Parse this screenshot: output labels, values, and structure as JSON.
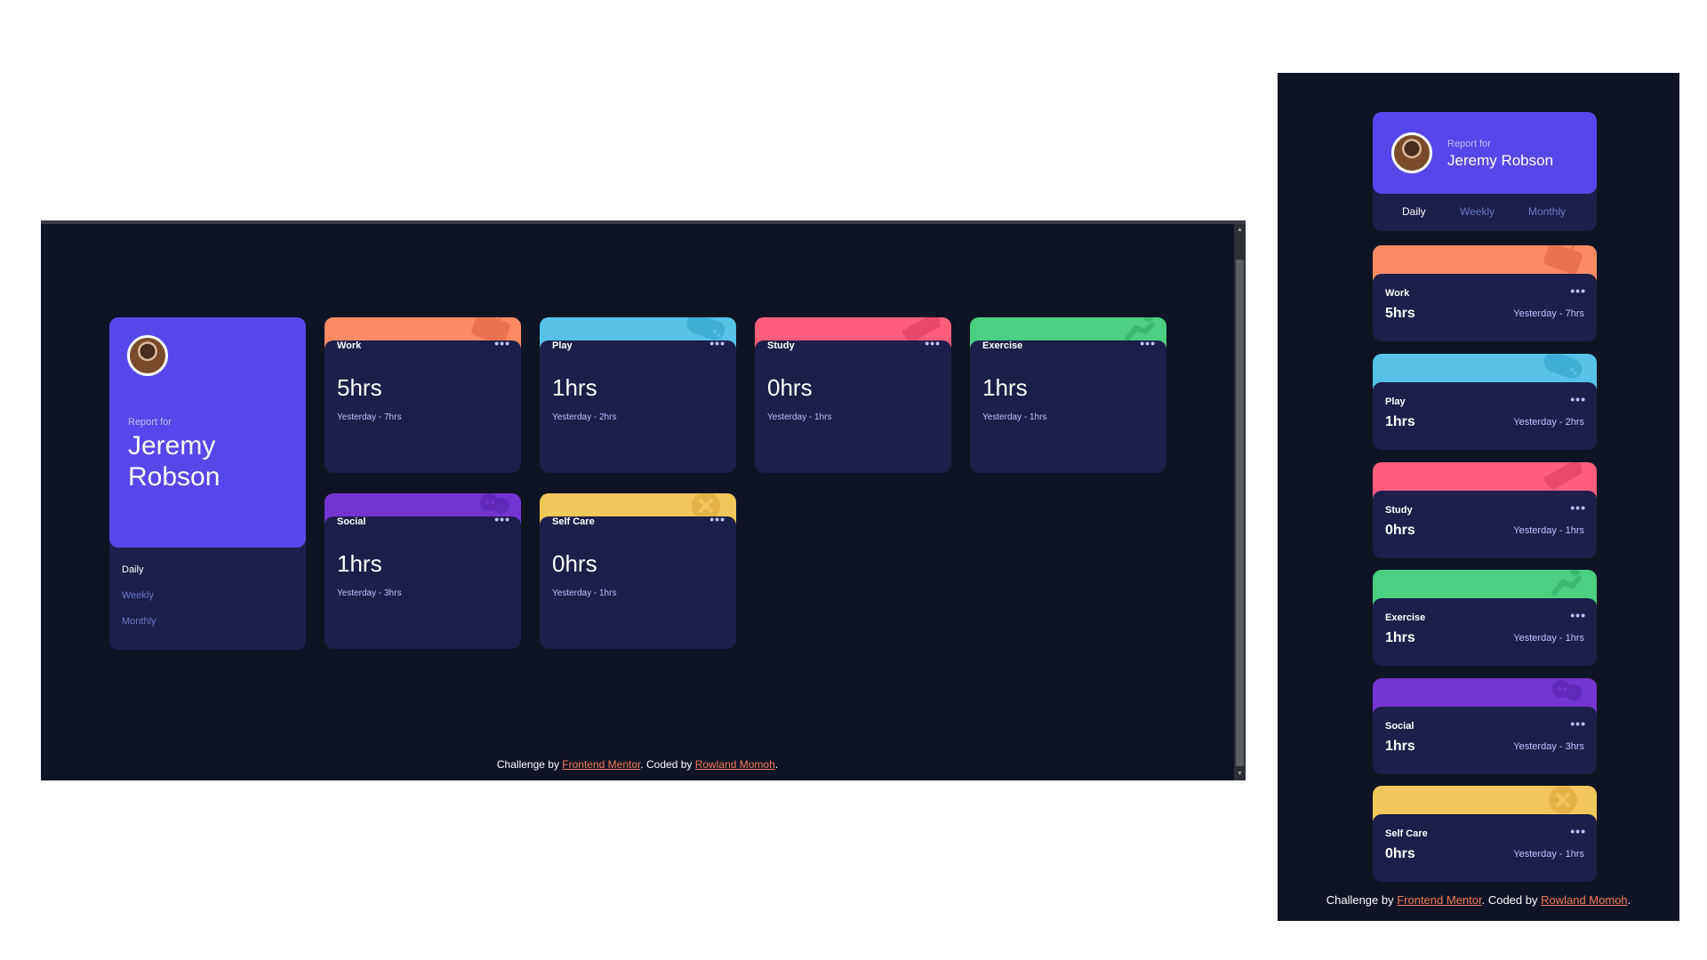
{
  "footer": {
    "prefix": "Challenge by ",
    "link1": "Frontend Mentor",
    "middle": ". Coded by ",
    "link2": "Rowland Momoh",
    "suffix": "."
  },
  "profile": {
    "report_for": "Report for",
    "name": "Jeremy Robson",
    "name_line1": "Jeremy",
    "name_line2": "Robson",
    "avatar_icon": "avatar-icon"
  },
  "periods": [
    "Daily",
    "Weekly",
    "Monthly"
  ],
  "active_period": "Daily",
  "activities": [
    {
      "title": "Work",
      "hours": "5hrs",
      "previous": "Yesterday - 7hrs",
      "color": "#ff8b64",
      "icon": "briefcase-icon"
    },
    {
      "title": "Play",
      "hours": "1hrs",
      "previous": "Yesterday - 2hrs",
      "color": "#55c2e6",
      "icon": "gamepad-icon"
    },
    {
      "title": "Study",
      "hours": "0hrs",
      "previous": "Yesterday - 1hrs",
      "color": "#ff5e7d",
      "icon": "book-icon"
    },
    {
      "title": "Exercise",
      "hours": "1hrs",
      "previous": "Yesterday - 1hrs",
      "color": "#4bcf82",
      "icon": "running-icon"
    },
    {
      "title": "Social",
      "hours": "1hrs",
      "previous": "Yesterday - 3hrs",
      "color": "#7235d1",
      "icon": "social-icon"
    },
    {
      "title": "Self Care",
      "hours": "0hrs",
      "previous": "Yesterday - 1hrs",
      "color": "#f1c65b",
      "icon": "heart-icon"
    }
  ],
  "menu_icon": "ellipsis-icon",
  "colors": {
    "page_bg": "#0f1424",
    "card_bg": "#1c1f4a",
    "accent": "#5747ea",
    "muted_text": "#bdc1ff",
    "link": "#f47b5a"
  }
}
